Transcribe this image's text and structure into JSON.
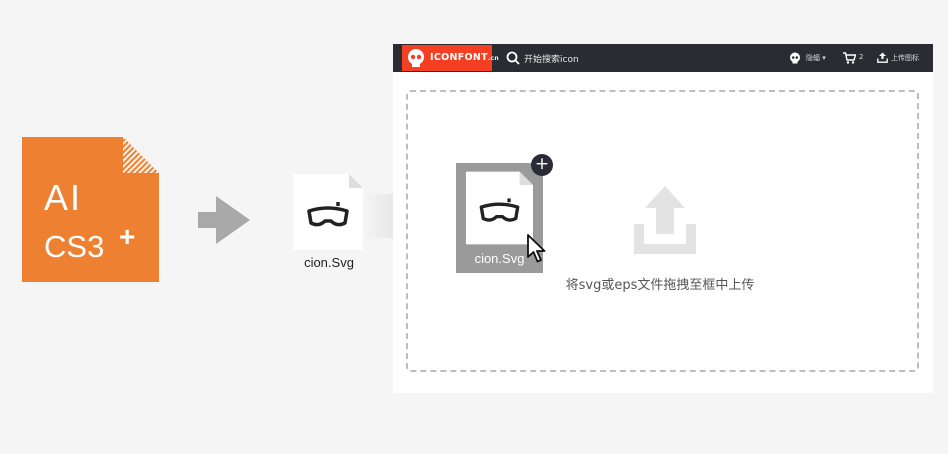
{
  "ai_file": {
    "line1": "AI",
    "line2": "CS3",
    "plus": "+",
    "color": "#ee8131"
  },
  "svg_file": {
    "label": "cion.Svg"
  },
  "site": {
    "logo_text": "ICONFONT",
    "logo_suffix": ".cn",
    "search_placeholder": "开始搜索icon",
    "user_label": "隐蝠 ▾",
    "cart_count": "2",
    "upload_label": "上传图标",
    "brand_color": "#f43f23",
    "topbar_color": "#2b2b33"
  },
  "drag_item": {
    "label": "cion.Svg",
    "add_symbol": "+"
  },
  "dropzone": {
    "text": "将svg或eps文件拖拽至框中上传"
  }
}
